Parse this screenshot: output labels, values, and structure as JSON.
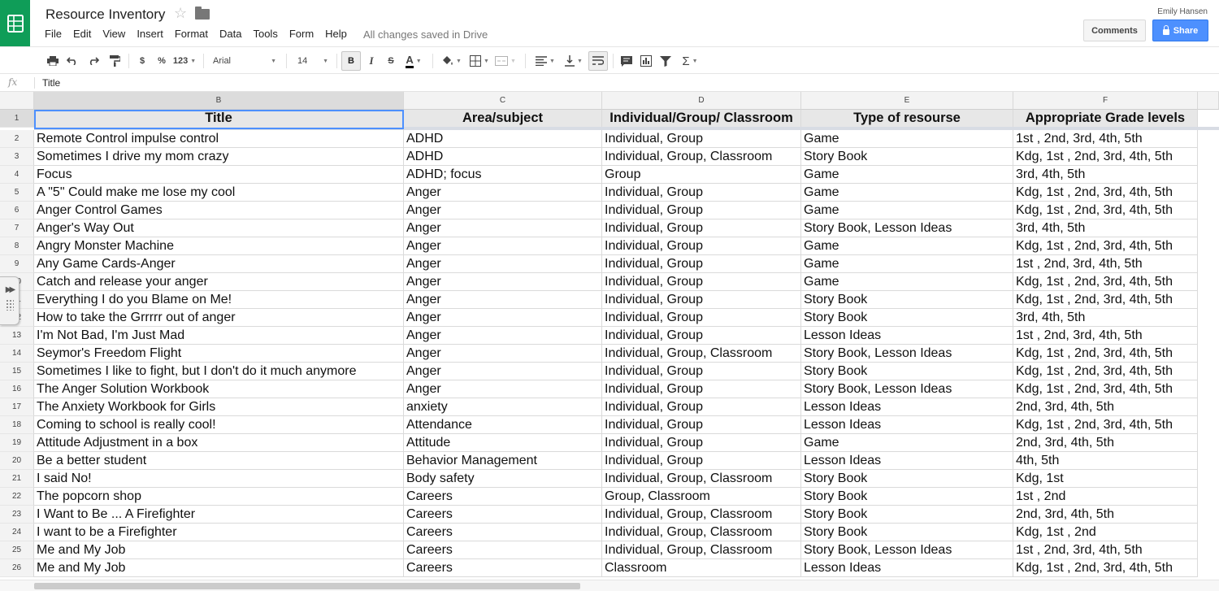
{
  "app": {
    "doc_title": "Resource Inventory",
    "user_name": "Emily Hansen",
    "save_status": "All changes saved in Drive",
    "comments_label": "Comments",
    "share_label": "Share"
  },
  "menu": [
    "File",
    "Edit",
    "View",
    "Insert",
    "Format",
    "Data",
    "Tools",
    "Form",
    "Help"
  ],
  "toolbar": {
    "currency": "$",
    "percent": "%",
    "more_formats": "123",
    "font": "Arial",
    "font_size": "14",
    "bold": "B",
    "italic": "I",
    "strike": "S",
    "text_color": "A",
    "sum": "Σ",
    "icons": [
      "print-icon",
      "undo-icon",
      "redo-icon",
      "paint-format-icon",
      "fill-color-icon",
      "borders-icon",
      "merge-cells-icon",
      "align-horizontal-icon",
      "align-vertical-icon",
      "wrap-text-icon",
      "insert-comment-icon",
      "insert-chart-icon",
      "filter-icon",
      "functions-icon"
    ]
  },
  "formula_bar": {
    "fx": "fx",
    "value": "Title"
  },
  "grid": {
    "column_letters": [
      "B",
      "C",
      "D",
      "E",
      "F"
    ],
    "header_row": {
      "row_num": "1",
      "cells": [
        "Title",
        "Area/subject",
        "Individual/Group/ Classroom",
        "Type of resourse",
        "Appropriate Grade levels"
      ]
    },
    "rows": [
      {
        "n": "2",
        "c": [
          "Remote Control impulse control",
          "ADHD",
          "Individual, Group",
          "Game",
          "1st , 2nd, 3rd, 4th, 5th"
        ]
      },
      {
        "n": "3",
        "c": [
          "Sometimes I drive my mom crazy",
          "ADHD",
          "Individual, Group, Classroom",
          "Story Book",
          "Kdg, 1st , 2nd, 3rd, 4th, 5th"
        ]
      },
      {
        "n": "4",
        "c": [
          "Focus",
          "ADHD; focus",
          "Group",
          "Game",
          "3rd, 4th, 5th"
        ]
      },
      {
        "n": "5",
        "c": [
          "A \"5\" Could make me lose my cool",
          "Anger",
          "Individual, Group",
          "Game",
          "Kdg, 1st , 2nd, 3rd, 4th, 5th"
        ]
      },
      {
        "n": "6",
        "c": [
          "Anger Control Games",
          "Anger",
          "Individual, Group",
          "Game",
          "Kdg, 1st , 2nd, 3rd, 4th, 5th"
        ]
      },
      {
        "n": "7",
        "c": [
          "Anger's Way Out",
          "Anger",
          "Individual, Group",
          "Story Book, Lesson Ideas",
          "3rd, 4th, 5th"
        ]
      },
      {
        "n": "8",
        "c": [
          "Angry Monster Machine",
          "Anger",
          "Individual, Group",
          "Game",
          "Kdg, 1st , 2nd, 3rd, 4th, 5th"
        ]
      },
      {
        "n": "9",
        "c": [
          "Any Game Cards-Anger",
          "Anger",
          "Individual, Group",
          "Game",
          "1st , 2nd, 3rd, 4th, 5th"
        ]
      },
      {
        "n": "10",
        "c": [
          "Catch and release your anger",
          "Anger",
          "Individual, Group",
          "Game",
          "Kdg, 1st , 2nd, 3rd, 4th, 5th"
        ]
      },
      {
        "n": "11",
        "c": [
          "Everything I do you Blame on Me!",
          "Anger",
          "Individual, Group",
          "Story Book",
          "Kdg, 1st , 2nd, 3rd, 4th, 5th"
        ]
      },
      {
        "n": "12",
        "c": [
          "How to take the Grrrrr out of anger",
          "Anger",
          "Individual, Group",
          "Story Book",
          "3rd, 4th, 5th"
        ]
      },
      {
        "n": "13",
        "c": [
          "I'm Not Bad, I'm Just Mad",
          "Anger",
          "Individual, Group",
          "Lesson Ideas",
          "1st , 2nd, 3rd, 4th, 5th"
        ]
      },
      {
        "n": "14",
        "c": [
          "Seymor's Freedom Flight",
          "Anger",
          "Individual, Group, Classroom",
          "Story Book, Lesson Ideas",
          "Kdg, 1st , 2nd, 3rd, 4th, 5th"
        ]
      },
      {
        "n": "15",
        "c": [
          "Sometimes I like to fight, but I don't do it much anymore",
          "Anger",
          "Individual, Group",
          "Story Book",
          "Kdg, 1st , 2nd, 3rd, 4th, 5th"
        ]
      },
      {
        "n": "16",
        "c": [
          "The Anger Solution Workbook",
          "Anger",
          "Individual, Group",
          "Story Book, Lesson Ideas",
          "Kdg, 1st , 2nd, 3rd, 4th, 5th"
        ]
      },
      {
        "n": "17",
        "c": [
          "The Anxiety Workbook for Girls",
          "anxiety",
          "Individual, Group",
          "Lesson Ideas",
          "2nd, 3rd, 4th, 5th"
        ]
      },
      {
        "n": "18",
        "c": [
          "Coming to school is really cool!",
          "Attendance",
          "Individual, Group",
          "Lesson Ideas",
          "Kdg, 1st , 2nd, 3rd, 4th, 5th"
        ]
      },
      {
        "n": "19",
        "c": [
          "Attitude Adjustment in a box",
          "Attitude",
          "Individual, Group",
          "Game",
          "2nd, 3rd, 4th, 5th"
        ]
      },
      {
        "n": "20",
        "c": [
          "Be a better student",
          "Behavior Management",
          "Individual, Group",
          "Lesson Ideas",
          "4th, 5th"
        ]
      },
      {
        "n": "21",
        "c": [
          "I said No!",
          "Body safety",
          "Individual, Group, Classroom",
          "Story Book",
          "Kdg, 1st"
        ]
      },
      {
        "n": "22",
        "c": [
          "The popcorn shop",
          "Careers",
          "Group, Classroom",
          "Story Book",
          "1st , 2nd"
        ]
      },
      {
        "n": "23",
        "c": [
          "I Want to Be ... A Firefighter",
          "Careers",
          "Individual, Group, Classroom",
          "Story Book",
          "2nd, 3rd, 4th, 5th"
        ]
      },
      {
        "n": "24",
        "c": [
          "I want to be a Firefighter",
          "Careers",
          "Individual, Group, Classroom",
          "Story Book",
          "Kdg, 1st , 2nd"
        ]
      },
      {
        "n": "25",
        "c": [
          "Me and My Job",
          "Careers",
          "Individual, Group, Classroom",
          "Story Book, Lesson Ideas",
          "1st , 2nd, 3rd, 4th, 5th"
        ]
      },
      {
        "n": "26",
        "c": [
          "Me and My Job",
          "Careers",
          "Classroom",
          "Lesson Ideas",
          "Kdg, 1st , 2nd, 3rd, 4th, 5th"
        ]
      }
    ]
  },
  "colors": {
    "brand_green": "#0f9d58",
    "share_blue": "#4d90fe",
    "selection_blue": "#4d90fe"
  }
}
